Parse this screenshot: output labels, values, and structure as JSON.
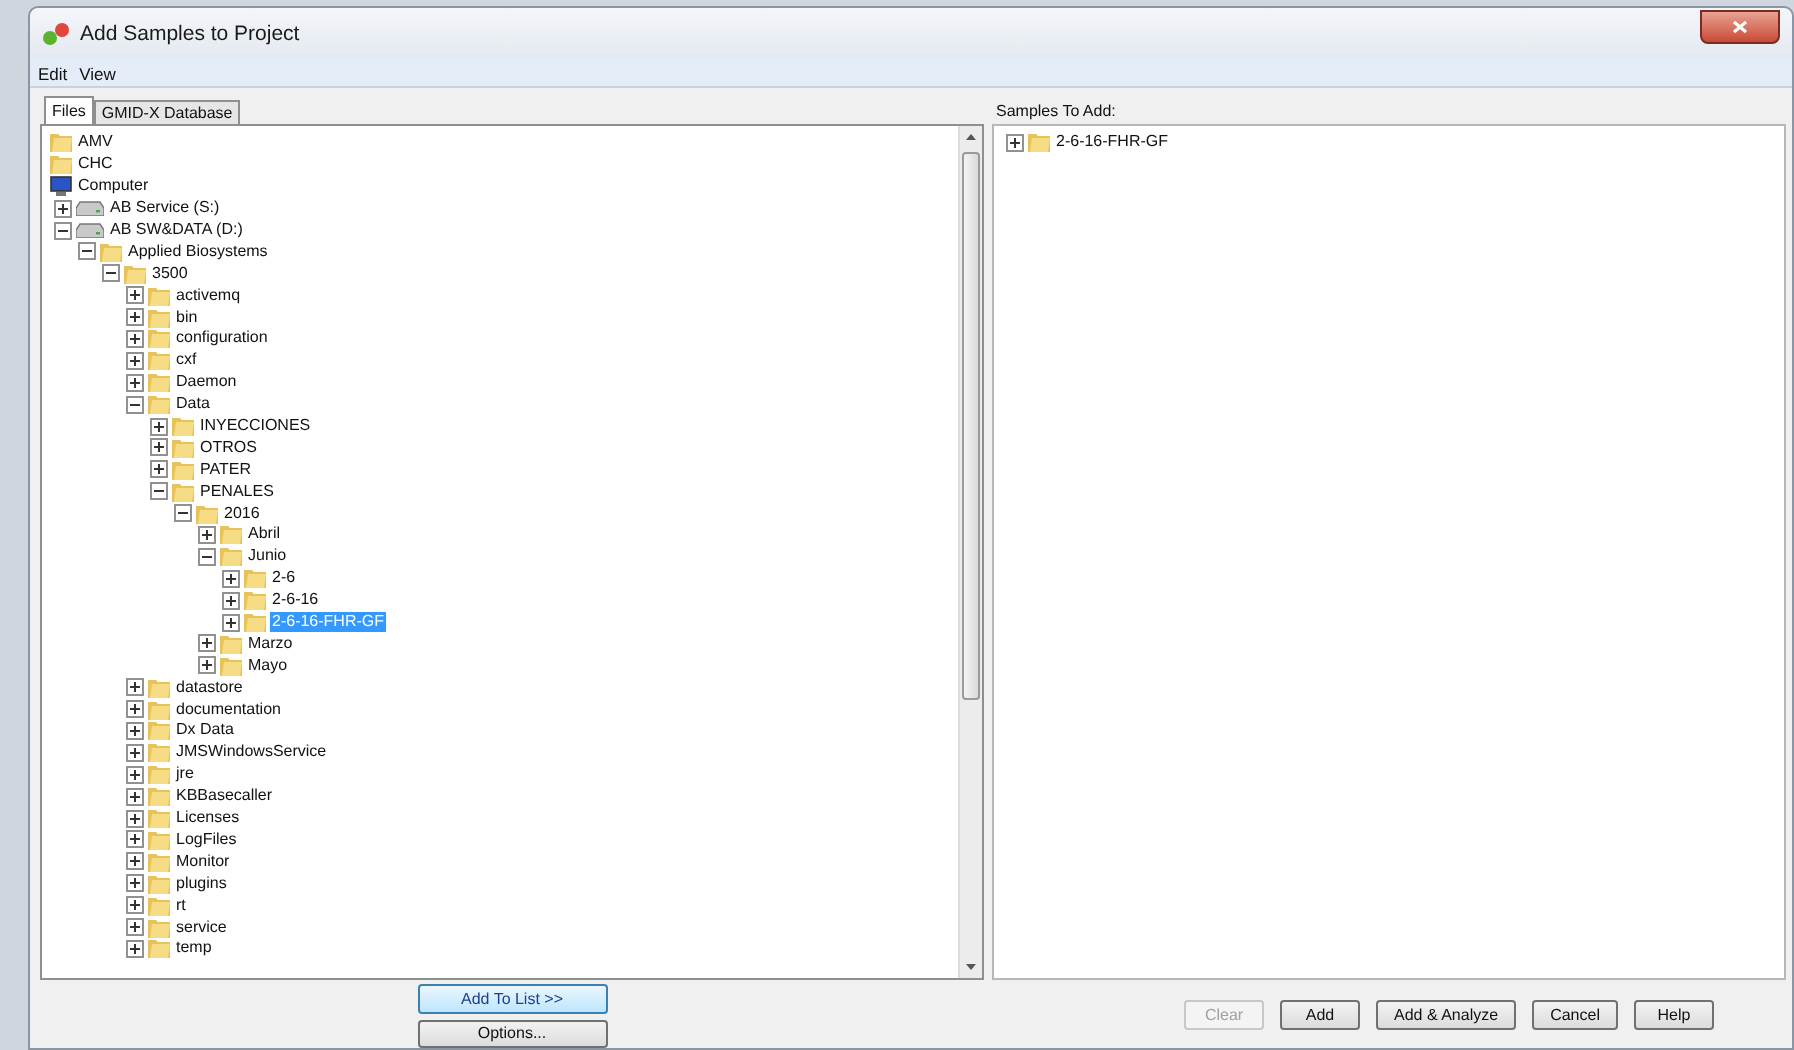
{
  "window": {
    "title": "Add Samples to Project"
  },
  "menu": [
    {
      "label": "Edit"
    },
    {
      "label": "View"
    }
  ],
  "tabs": [
    {
      "label": "Files",
      "selected": true
    },
    {
      "label": "GMID-X Database",
      "selected": false
    }
  ],
  "file_tree": [
    {
      "label": "AMV",
      "kind": "folder",
      "selected": false
    },
    {
      "label": "CHC",
      "kind": "folder",
      "selected": false
    },
    {
      "label": "Computer",
      "kind": "computer",
      "selected": false,
      "children": [
        {
          "label": "AB Service (S:)",
          "kind": "drive",
          "expanded": false,
          "selected": false
        },
        {
          "label": "AB SW&DATA (D:)",
          "kind": "drive",
          "expanded": true,
          "selected": false,
          "children": [
            {
              "label": "Applied Biosystems",
              "kind": "folder",
              "expanded": true,
              "selected": false,
              "children": [
                {
                  "label": "3500",
                  "kind": "folder",
                  "expanded": true,
                  "selected": false,
                  "children": [
                    {
                      "label": "activemq",
                      "kind": "folder",
                      "expanded": false,
                      "selected": false
                    },
                    {
                      "label": "bin",
                      "kind": "folder",
                      "expanded": false,
                      "selected": false
                    },
                    {
                      "label": "configuration",
                      "kind": "folder",
                      "expanded": false,
                      "selected": false
                    },
                    {
                      "label": "cxf",
                      "kind": "folder",
                      "expanded": false,
                      "selected": false
                    },
                    {
                      "label": "Daemon",
                      "kind": "folder",
                      "expanded": false,
                      "selected": false
                    },
                    {
                      "label": "Data",
                      "kind": "folder",
                      "expanded": true,
                      "selected": false,
                      "children": [
                        {
                          "label": "INYECCIONES",
                          "kind": "folder",
                          "expanded": false,
                          "selected": false
                        },
                        {
                          "label": "OTROS",
                          "kind": "folder",
                          "expanded": false,
                          "selected": false
                        },
                        {
                          "label": "PATER",
                          "kind": "folder",
                          "expanded": false,
                          "selected": false
                        },
                        {
                          "label": "PENALES",
                          "kind": "folder",
                          "expanded": true,
                          "selected": false,
                          "children": [
                            {
                              "label": "2016",
                              "kind": "folder",
                              "expanded": true,
                              "selected": false,
                              "children": [
                                {
                                  "label": "Abril",
                                  "kind": "folder",
                                  "expanded": false,
                                  "selected": false
                                },
                                {
                                  "label": "Junio",
                                  "kind": "folder",
                                  "expanded": true,
                                  "selected": false,
                                  "children": [
                                    {
                                      "label": "2-6",
                                      "kind": "folder",
                                      "expanded": false,
                                      "selected": false
                                    },
                                    {
                                      "label": "2-6-16",
                                      "kind": "folder",
                                      "expanded": false,
                                      "selected": false
                                    },
                                    {
                                      "label": "2-6-16-FHR-GF",
                                      "kind": "folder",
                                      "expanded": false,
                                      "selected": true
                                    }
                                  ]
                                },
                                {
                                  "label": "Marzo",
                                  "kind": "folder",
                                  "expanded": false,
                                  "selected": false
                                },
                                {
                                  "label": "Mayo",
                                  "kind": "folder",
                                  "expanded": false,
                                  "selected": false
                                }
                              ]
                            }
                          ]
                        }
                      ]
                    },
                    {
                      "label": "datastore",
                      "kind": "folder",
                      "expanded": false,
                      "selected": false
                    },
                    {
                      "label": "documentation",
                      "kind": "folder",
                      "expanded": false,
                      "selected": false
                    },
                    {
                      "label": "Dx Data",
                      "kind": "folder",
                      "expanded": false,
                      "selected": false
                    },
                    {
                      "label": "JMSWindowsService",
                      "kind": "folder",
                      "expanded": false,
                      "selected": false
                    },
                    {
                      "label": "jre",
                      "kind": "folder",
                      "expanded": false,
                      "selected": false
                    },
                    {
                      "label": "KBBasecaller",
                      "kind": "folder",
                      "expanded": false,
                      "selected": false
                    },
                    {
                      "label": "Licenses",
                      "kind": "folder",
                      "expanded": false,
                      "selected": false
                    },
                    {
                      "label": "LogFiles",
                      "kind": "folder",
                      "expanded": false,
                      "selected": false
                    },
                    {
                      "label": "Monitor",
                      "kind": "folder",
                      "expanded": false,
                      "selected": false
                    },
                    {
                      "label": "plugins",
                      "kind": "folder",
                      "expanded": false,
                      "selected": false
                    },
                    {
                      "label": "rt",
                      "kind": "folder",
                      "expanded": false,
                      "selected": false
                    },
                    {
                      "label": "service",
                      "kind": "folder",
                      "expanded": false,
                      "selected": false
                    },
                    {
                      "label": "temp",
                      "kind": "folder",
                      "expanded": false,
                      "selected": false
                    }
                  ]
                }
              ]
            }
          ]
        }
      ]
    }
  ],
  "samples_panel": {
    "label": "Samples To Add:",
    "items": [
      {
        "label": "2-6-16-FHR-GF",
        "kind": "folder",
        "expanded": false,
        "selected": false
      }
    ]
  },
  "left_buttons": [
    {
      "label": "Add To List >>",
      "default": true,
      "disabled": false
    },
    {
      "label": "Options...",
      "default": false,
      "disabled": false
    }
  ],
  "right_buttons": [
    {
      "label": "Clear",
      "default": false,
      "disabled": true
    },
    {
      "label": "Add",
      "default": false,
      "disabled": false
    },
    {
      "label": "Add & Analyze",
      "default": false,
      "disabled": false
    },
    {
      "label": "Cancel",
      "default": false,
      "disabled": false
    },
    {
      "label": "Help",
      "default": false,
      "disabled": false
    }
  ]
}
